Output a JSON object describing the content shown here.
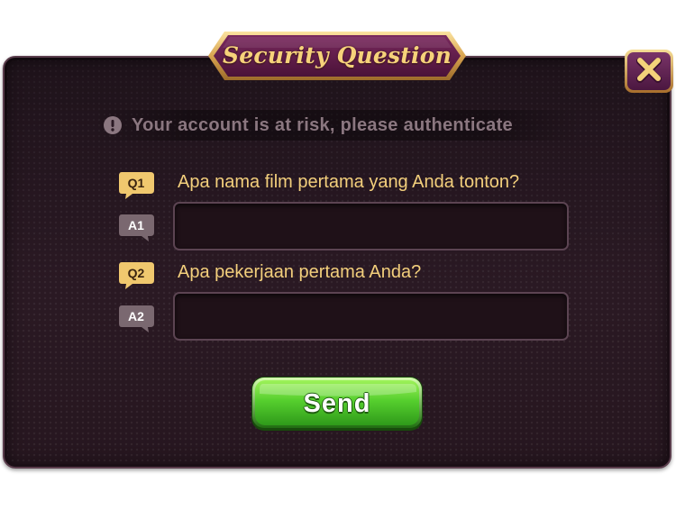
{
  "dialog": {
    "title": "Security Question",
    "close_icon": "close-icon",
    "warning": {
      "icon": "exclamation-circle-icon",
      "text": "Your account is at risk, please authenticate"
    },
    "questions": [
      {
        "question_tag": "Q1",
        "question": "Apa nama film pertama yang Anda tonton?",
        "answer_tag": "A1",
        "answer_value": "",
        "answer_placeholder": ""
      },
      {
        "question_tag": "Q2",
        "question": "Apa pekerjaan pertama Anda?",
        "answer_tag": "A2",
        "answer_value": "",
        "answer_placeholder": ""
      }
    ],
    "send_label": "Send"
  },
  "colors": {
    "panel_bg": "#2a1923",
    "title_gold": "#f6d27a",
    "banner_purple": "#5c1d48",
    "question_gold": "#f3cf7c",
    "question_tag_gold": "#f0c86e",
    "answer_tag_gray": "#7a6870",
    "warning_text": "#8b7780",
    "send_green": "#4cc62c",
    "close_gold": "#f4d37a"
  }
}
